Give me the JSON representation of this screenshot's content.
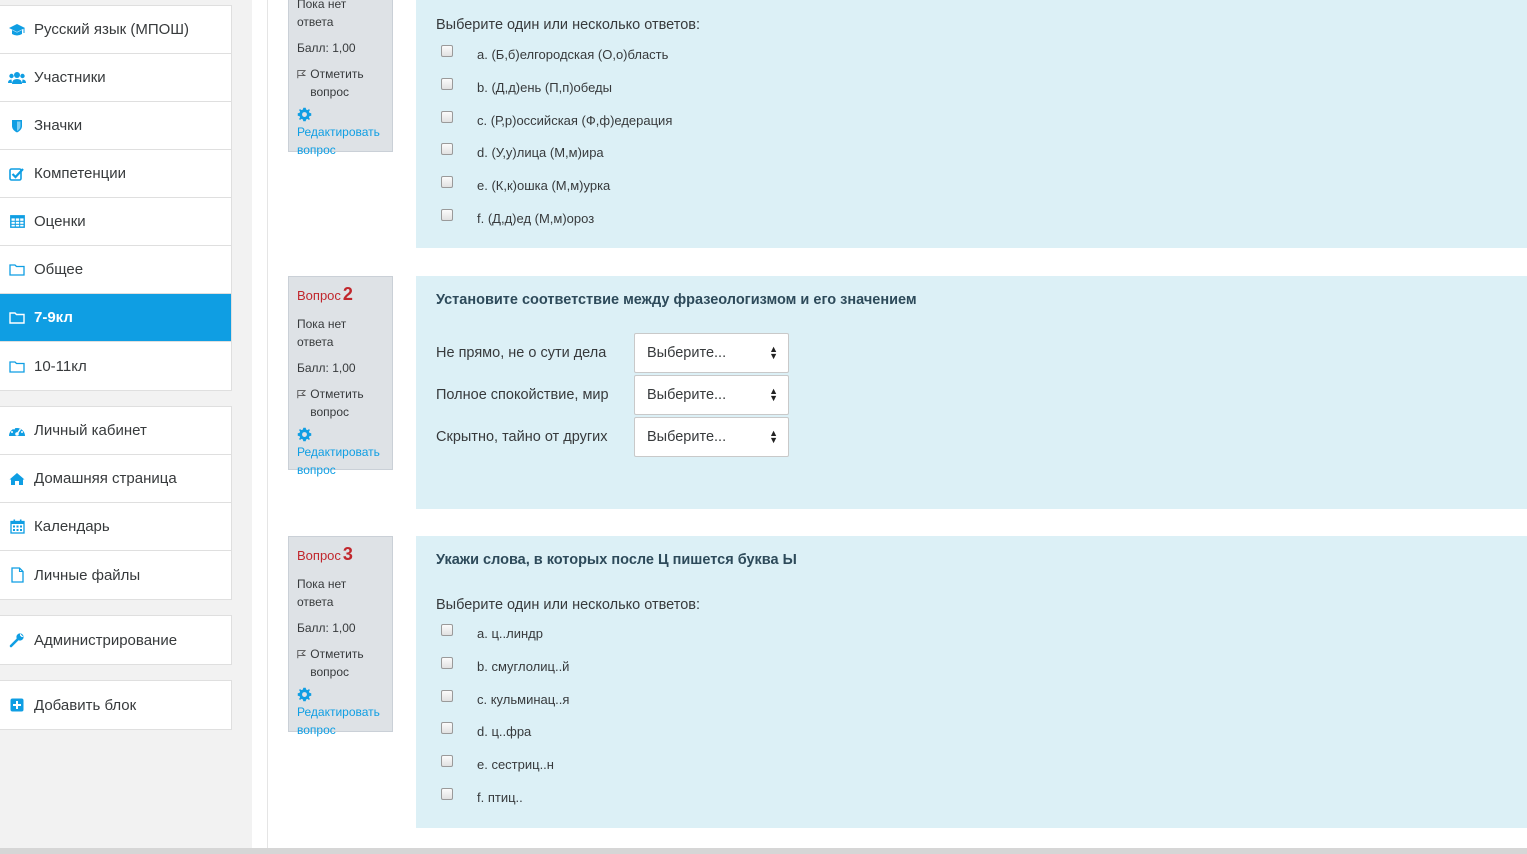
{
  "sidebar": {
    "course_nav": [
      {
        "label": "Русский язык (МПОШ)",
        "icon": "graduation-cap-icon"
      },
      {
        "label": "Участники",
        "icon": "users-icon"
      },
      {
        "label": "Значки",
        "icon": "shield-icon"
      },
      {
        "label": "Компетенции",
        "icon": "checkbox-icon"
      },
      {
        "label": "Оценки",
        "icon": "table-icon"
      },
      {
        "label": "Общее",
        "icon": "folder-icon"
      },
      {
        "label": "7-9кл",
        "icon": "folder-icon",
        "active": true
      },
      {
        "label": "10-11кл",
        "icon": "folder-icon"
      }
    ],
    "site_nav": [
      {
        "label": "Личный кабинет",
        "icon": "dashboard-icon"
      },
      {
        "label": "Домашняя страница",
        "icon": "home-icon"
      },
      {
        "label": "Календарь",
        "icon": "calendar-icon"
      },
      {
        "label": "Личные файлы",
        "icon": "file-icon"
      }
    ],
    "admin": {
      "label": "Администрирование",
      "icon": "wrench-icon"
    },
    "add_block": {
      "label": "Добавить блок",
      "icon": "plus-square-icon"
    }
  },
  "accent_color": "#0f9ee3",
  "questions": [
    {
      "info": {
        "status": "Пока нет ответа",
        "grade": "Балл: 1,00",
        "flag_label": "Отметить вопрос",
        "edit_label": "Редактировать вопрос"
      },
      "prompt": "Выберите один или несколько ответов:",
      "answers": [
        "a. (Б,б)елгородская (О,о)бласть",
        "b. (Д,д)ень (П,п)обеды",
        "c. (Р,р)оссийская (Ф,ф)едерация",
        "d. (У,у)лица (М,м)ира",
        "e. (К,к)ошка (М,м)урка",
        "f. (Д,д)ед (М,м)ороз"
      ]
    },
    {
      "info": {
        "label": "Вопрос",
        "number": "2",
        "status": "Пока нет ответа",
        "grade": "Балл: 1,00",
        "flag_label": "Отметить вопрос",
        "edit_label": "Редактировать вопрос"
      },
      "text": "Установите соответствие между фразеологизмом и его значением",
      "matches": [
        {
          "label": "Не прямо, не о сути дела",
          "selected": "Выберите..."
        },
        {
          "label": "Полное спокойствие, мир",
          "selected": "Выберите..."
        },
        {
          "label": "Скрытно, тайно от других",
          "selected": "Выберите..."
        }
      ]
    },
    {
      "info": {
        "label": "Вопрос",
        "number": "3",
        "status": "Пока нет ответа",
        "grade": "Балл: 1,00",
        "flag_label": "Отметить вопрос",
        "edit_label": "Редактировать вопрос"
      },
      "text": "Укажи слова, в которых после Ц пишется буква Ы",
      "prompt": "Выберите один или несколько ответов:",
      "answers": [
        "a. ц..линдр",
        "b. смуглолиц..й",
        "c. кульминац..я",
        "d. ц..фра",
        "e. сестриц..н",
        "f. птиц.."
      ]
    }
  ]
}
